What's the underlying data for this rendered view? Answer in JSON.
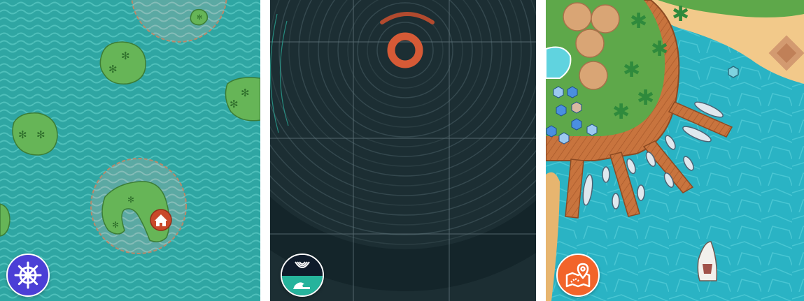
{
  "panels": [
    {
      "id": "sea-map",
      "button_icon": "ship-wheel-icon",
      "colors": {
        "sea": "#2fa6a3",
        "island": "#66b557",
        "house_marker": "#c9492a",
        "button": "#4b3fd6"
      }
    },
    {
      "id": "radar",
      "button_icon": "sonar-wave-icon",
      "colors": {
        "background": "#1c2e33",
        "ring": "#3a4d52",
        "target": "#d65a36",
        "button_top": "#0e1b2a",
        "button_bottom": "#26b39c"
      }
    },
    {
      "id": "resort",
      "button_icon": "map-pin-icon",
      "colors": {
        "water": "#2ab3c4",
        "sand": "#f2c98a",
        "deck": "#c8743e",
        "button": "#f2642a"
      }
    }
  ]
}
